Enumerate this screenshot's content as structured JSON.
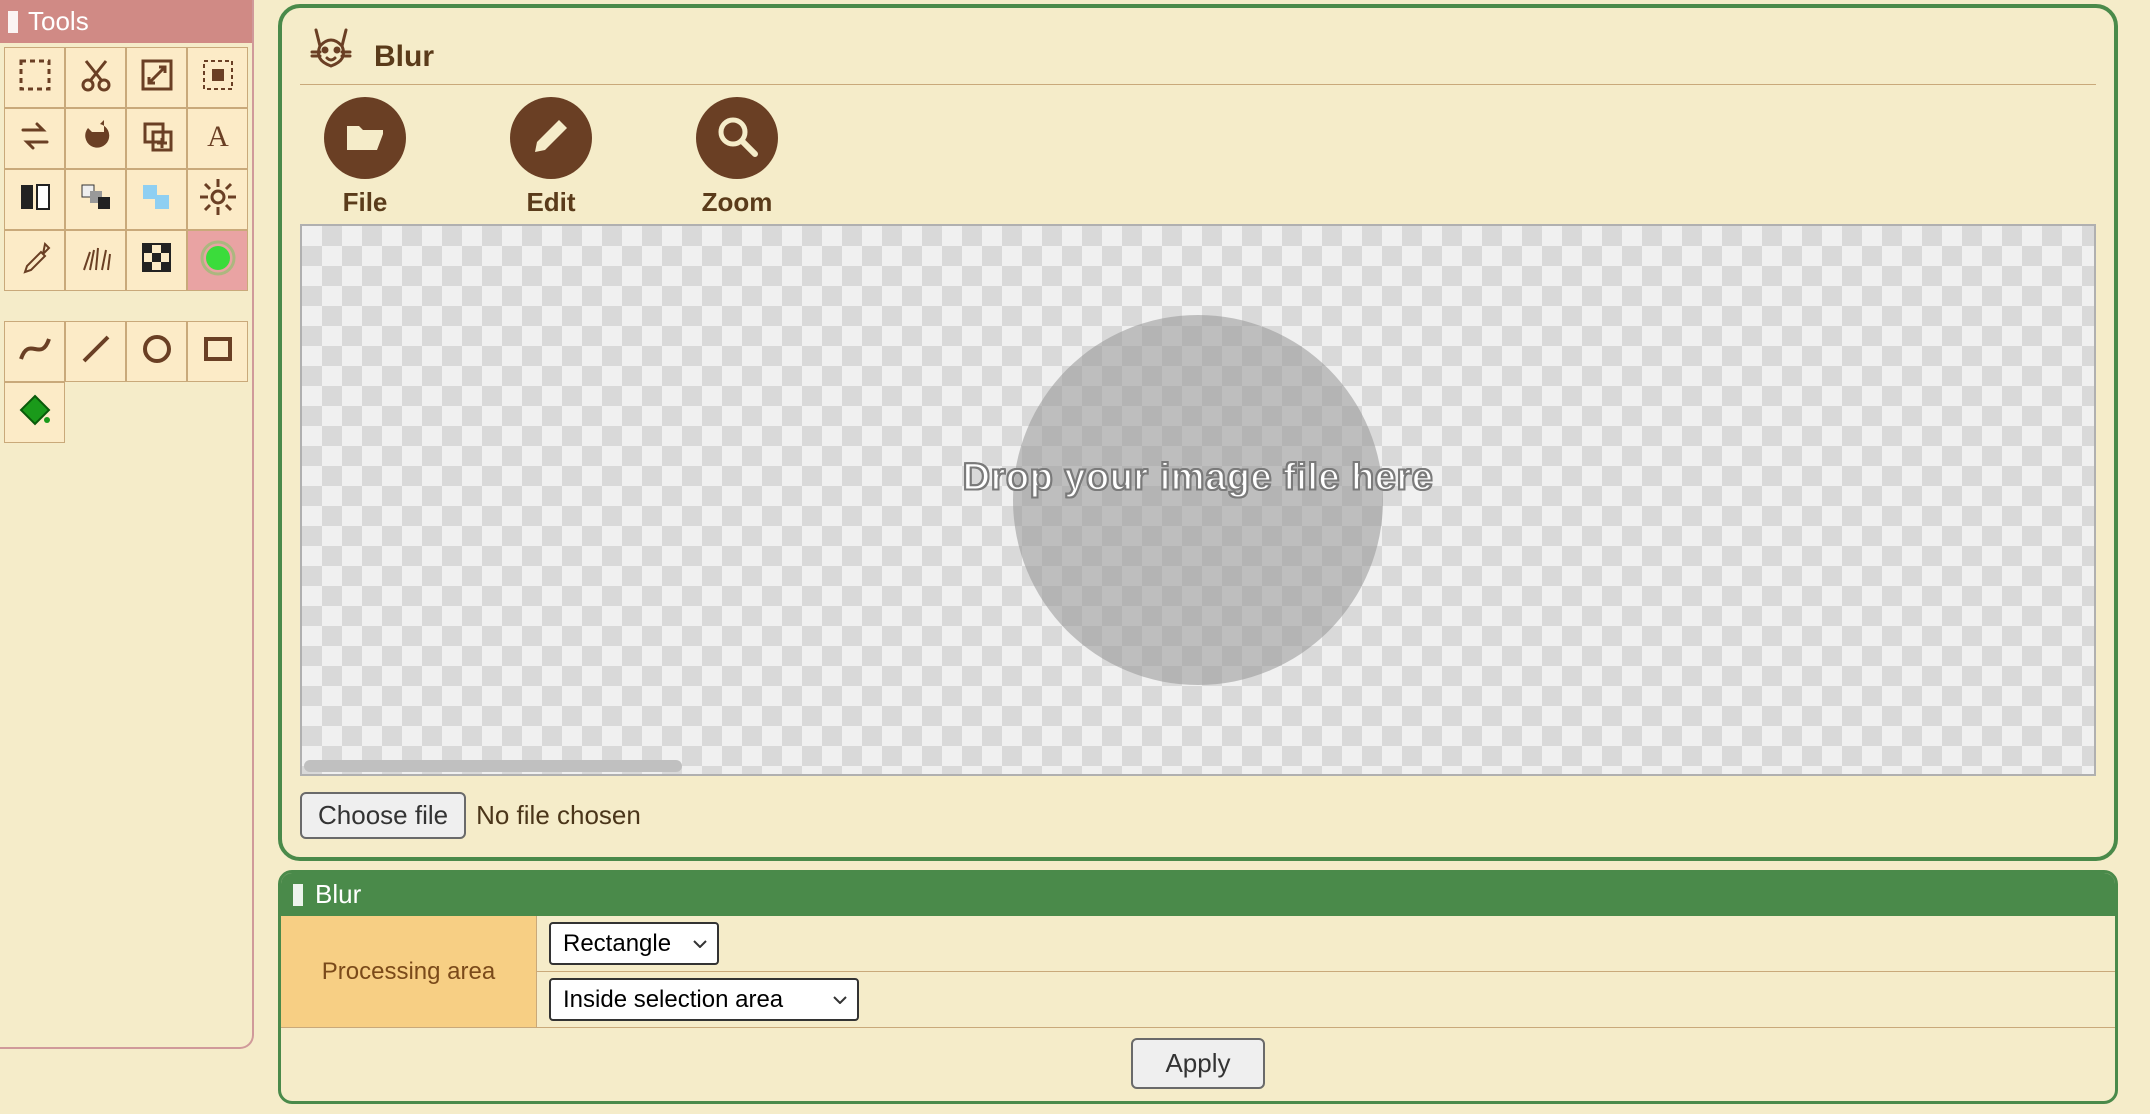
{
  "tools_panel": {
    "title": "Tools",
    "items": [
      {
        "name": "select-rect-icon"
      },
      {
        "name": "cut-icon"
      },
      {
        "name": "resize-icon"
      },
      {
        "name": "marquee-icon"
      },
      {
        "name": "swap-icon"
      },
      {
        "name": "redo-icon"
      },
      {
        "name": "copy-icon"
      },
      {
        "name": "text-icon"
      },
      {
        "name": "contrast-icon"
      },
      {
        "name": "levels-icon"
      },
      {
        "name": "clone-icon"
      },
      {
        "name": "brightness-icon"
      },
      {
        "name": "eyedropper-icon"
      },
      {
        "name": "burst-icon"
      },
      {
        "name": "checker-icon"
      },
      {
        "name": "blur-icon",
        "selected": true
      },
      {
        "name": "curve-icon"
      },
      {
        "name": "line-icon"
      },
      {
        "name": "circle-icon"
      },
      {
        "name": "rect-icon"
      },
      {
        "name": "bucket-icon"
      }
    ]
  },
  "main": {
    "title": "Blur",
    "actions": [
      {
        "name": "file",
        "label": "File"
      },
      {
        "name": "edit",
        "label": "Edit"
      },
      {
        "name": "zoom",
        "label": "Zoom"
      }
    ],
    "drop_text": "Drop your image file here",
    "choose_file_label": "Choose file",
    "no_file_label": "No file chosen"
  },
  "settings": {
    "title": "Blur",
    "processing_area_label": "Processing area",
    "shape_value": "Rectangle",
    "area_value": "Inside selection area",
    "apply_label": "Apply"
  }
}
